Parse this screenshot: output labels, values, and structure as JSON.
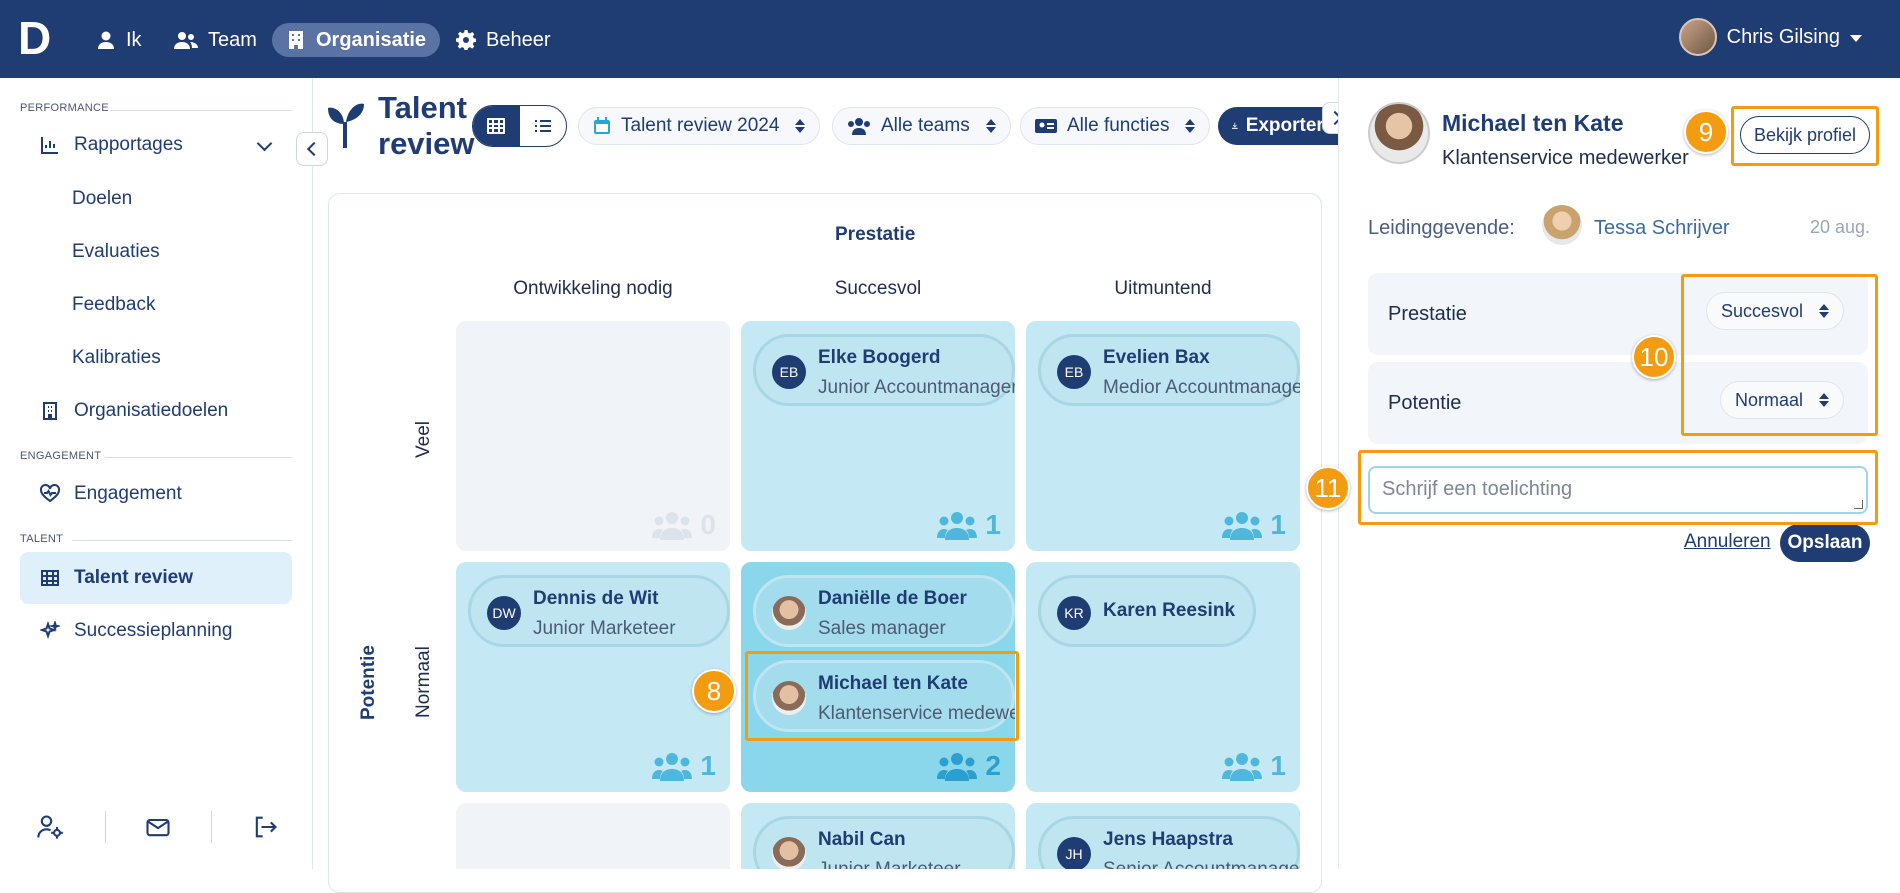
{
  "app": {
    "logo": "D"
  },
  "topnav": {
    "items": [
      {
        "label": "Ik",
        "icon": "user-icon"
      },
      {
        "label": "Team",
        "icon": "users-icon"
      },
      {
        "label": "Organisatie",
        "icon": "building-icon",
        "active": true
      },
      {
        "label": "Beheer",
        "icon": "gear-icon"
      }
    ],
    "user_name": "Chris Gilsing"
  },
  "sidebar": {
    "sections": {
      "performance": "PERFORMANCE",
      "engagement": "ENGAGEMENT",
      "talent": "TALENT"
    },
    "items": {
      "rapportages": "Rapportages",
      "doelen": "Doelen",
      "evaluaties": "Evaluaties",
      "feedback": "Feedback",
      "kalibraties": "Kalibraties",
      "organisatiedoelen": "Organisatiedoelen",
      "engagement": "Engagement",
      "talent_review": "Talent review",
      "successieplanning": "Successieplanning"
    }
  },
  "header": {
    "title": "Talent review",
    "filters": {
      "review": "Talent review 2024",
      "teams": "Alle teams",
      "functions": "Alle functies"
    },
    "export_label": "Exporteren"
  },
  "grid": {
    "x_axis": "Prestatie",
    "y_axis": "Potentie",
    "columns": [
      "Ontwikkeling nodig",
      "Succesvol",
      "Uitmuntend"
    ],
    "rows": [
      "Veel",
      "Normaal"
    ],
    "cells": {
      "r0c0": {
        "count": "0"
      },
      "r0c1": {
        "count": "1",
        "people": [
          {
            "initials": "EB",
            "name": "Elke Boogerd",
            "role": "Junior Accountmanager"
          }
        ]
      },
      "r0c2": {
        "count": "1",
        "people": [
          {
            "initials": "EB",
            "name": "Evelien Bax",
            "role": "Medior Accountmanager"
          }
        ]
      },
      "r1c0": {
        "count": "1",
        "people": [
          {
            "initials": "DW",
            "name": "Dennis de Wit",
            "role": "Junior Marketeer"
          }
        ]
      },
      "r1c1": {
        "count": "2",
        "people": [
          {
            "name": "Daniëlle de Boer",
            "role": "Sales manager"
          },
          {
            "name": "Michael ten Kate",
            "role": "Klantenservice medewerker"
          }
        ]
      },
      "r1c2": {
        "count": "1",
        "people": [
          {
            "initials": "KR",
            "name": "Karen Reesink"
          }
        ]
      },
      "r2c1": {
        "people": [
          {
            "name": "Nabil Can",
            "role": "Junior Marketeer"
          }
        ]
      },
      "r2c2": {
        "people": [
          {
            "initials": "JH",
            "name": "Jens Haapstra",
            "role": "Senior Accountmanager"
          }
        ]
      }
    }
  },
  "panel": {
    "name": "Michael ten Kate",
    "role": "Klantenservice medewerker",
    "profile_button": "Bekijk profiel",
    "lead_label": "Leidinggevende:",
    "lead_name": "Tessa Schrijver",
    "date": "20 aug.",
    "prestatie_label": "Prestatie",
    "prestatie_value": "Succesvol",
    "potentie_label": "Potentie",
    "potentie_value": "Normaal",
    "comment_placeholder": "Schrijf een toelichting",
    "cancel": "Annuleren",
    "save": "Opslaan"
  },
  "callouts": [
    "8",
    "9",
    "10",
    "11"
  ],
  "colors": {
    "brand": "#1f3c73",
    "highlight": "#f39c12",
    "cell": "#c5e9f4"
  }
}
